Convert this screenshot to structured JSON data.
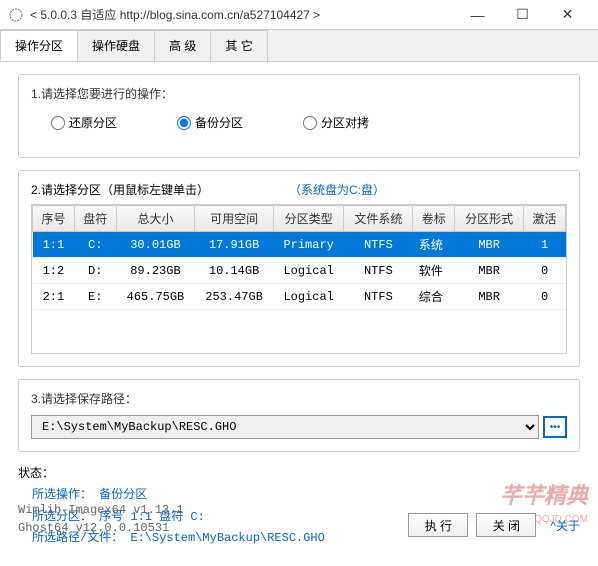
{
  "window": {
    "title": "< 5.0.0.3 自适应 http://blog.sina.com.cn/a527104427 >"
  },
  "tabs": {
    "t0": "操作分区",
    "t1": "操作硬盘",
    "t2": "高 级",
    "t3": "其 它"
  },
  "section1": {
    "label": "1.请选择您要进行的操作：",
    "opt_restore": "还原分区",
    "opt_backup": "备份分区",
    "opt_copy": "分区对拷"
  },
  "section2": {
    "label": "2.请选择分区（用鼠标左键单击）",
    "sysdisk": "（系统盘为C:盘）",
    "headers": {
      "seq": "序号",
      "drive": "盘符",
      "total": "总大小",
      "free": "可用空间",
      "ptype": "分区类型",
      "fs": "文件系统",
      "vol": "卷标",
      "pstyle": "分区形式",
      "active": "激活"
    },
    "rows": [
      {
        "seq": "1:1",
        "drive": "C:",
        "total": "30.01GB",
        "free": "17.91GB",
        "ptype": "Primary",
        "fs": "NTFS",
        "vol": "系统",
        "pstyle": "MBR",
        "active": "1"
      },
      {
        "seq": "1:2",
        "drive": "D:",
        "total": "89.23GB",
        "free": "10.14GB",
        "ptype": "Logical",
        "fs": "NTFS",
        "vol": "软件",
        "pstyle": "MBR",
        "active": "0"
      },
      {
        "seq": "2:1",
        "drive": "E:",
        "total": "465.75GB",
        "free": "253.47GB",
        "ptype": "Logical",
        "fs": "NTFS",
        "vol": "综合",
        "pstyle": "MBR",
        "active": "0"
      }
    ]
  },
  "section3": {
    "label": "3.请选择保存路径：",
    "path": "E:\\System\\MyBackup\\RESC.GHO"
  },
  "status": {
    "label": "状态：",
    "line1": "所选操作： 备份分区",
    "line2": "所选分区：  序号 1:1         盘符  C:",
    "line3": "所选路径/文件： E:\\System\\MyBackup\\RESC.GHO"
  },
  "version": {
    "line1": "Wimlib-Imagex64 v1.13.1",
    "line2": "Ghost64 v12.0.0.10531"
  },
  "buttons": {
    "exec": "执 行",
    "close": "关 闭",
    "about": "^关于"
  },
  "watermark": {
    "main": "芊芊精典",
    "sub": "MYQQJD.COM"
  }
}
